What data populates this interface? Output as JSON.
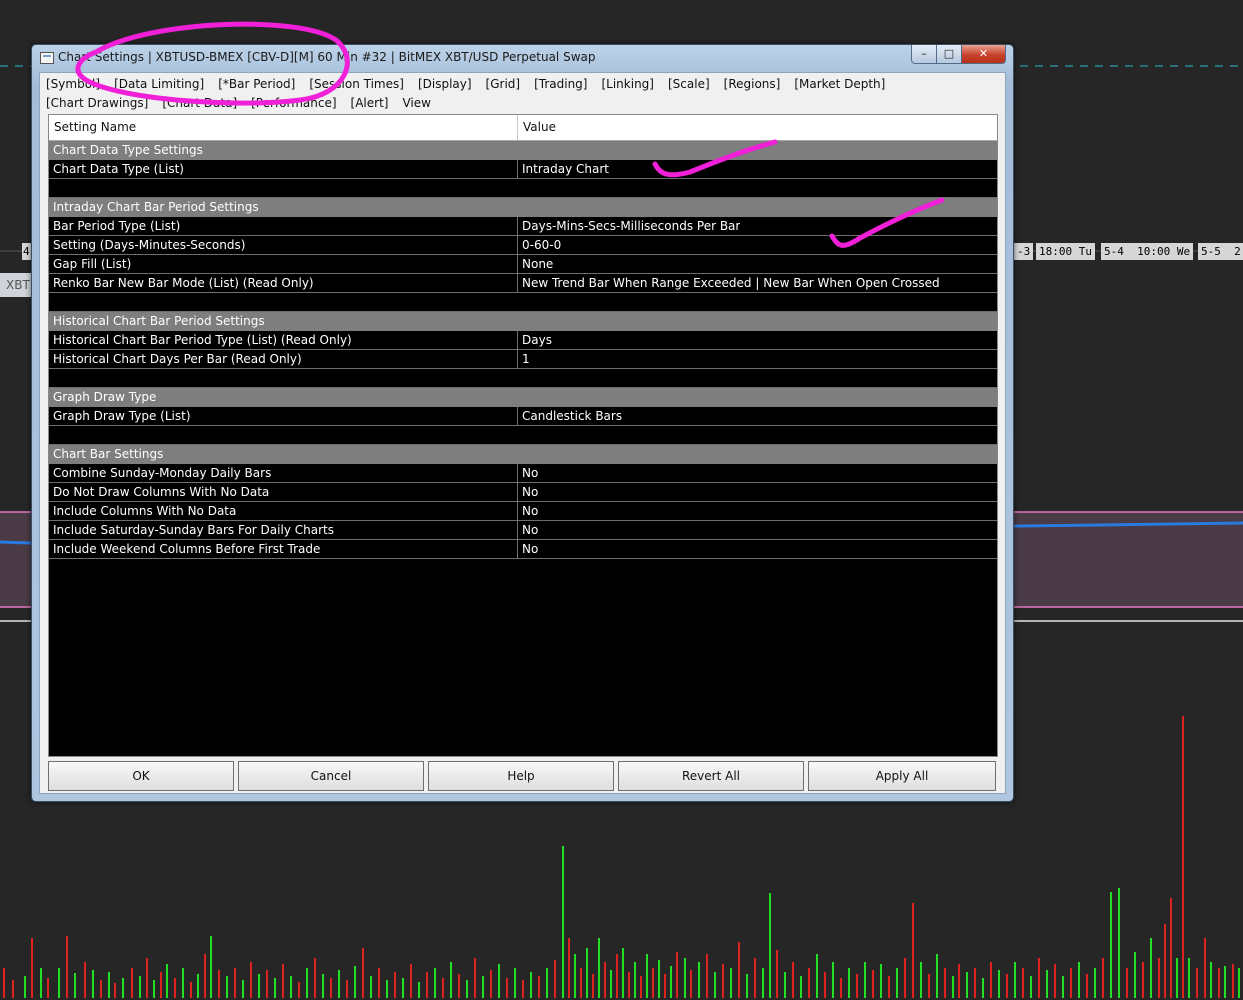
{
  "window": {
    "title": "Chart Settings | XBTUSD-BMEX [CBV-D][M]  60 Min  #32 | BitMEX XBT/USD Perpetual Swap",
    "min_glyph": "–",
    "max_glyph": "□",
    "close_glyph": "✕"
  },
  "tabs": [
    "[Symbol]",
    "[Data Limiting]",
    "[*Bar Period]",
    "[Session Times]",
    "[Display]",
    "[Grid]",
    "[Trading]",
    "[Linking]",
    "[Scale]",
    "[Regions]",
    "[Market Depth]",
    "[Chart Drawings]",
    "[Chart Data]",
    "[Performance]",
    "[Alert]",
    "View"
  ],
  "grid": {
    "headers": {
      "name": "Setting Name",
      "value": "Value"
    },
    "rows": [
      {
        "type": "section",
        "name": "Chart Data Type Settings"
      },
      {
        "type": "setting",
        "name": "Chart Data Type (List)",
        "value": "Intraday Chart"
      },
      {
        "type": "blank"
      },
      {
        "type": "section",
        "name": "Intraday Chart Bar Period Settings"
      },
      {
        "type": "setting",
        "name": "Bar Period Type (List)",
        "value": "Days-Mins-Secs-Milliseconds Per Bar"
      },
      {
        "type": "setting",
        "name": "Setting (Days-Minutes-Seconds)",
        "value": "0-60-0"
      },
      {
        "type": "setting",
        "name": "Gap Fill (List)",
        "value": "None"
      },
      {
        "type": "setting",
        "name": "Renko Bar New Bar Mode (List) (Read Only)",
        "value": "New Trend Bar When Range Exceeded | New Bar When Open Crossed"
      },
      {
        "type": "blank"
      },
      {
        "type": "section",
        "name": "Historical Chart Bar Period Settings"
      },
      {
        "type": "setting",
        "name": "Historical Chart Bar Period Type (List) (Read Only)",
        "value": "Days"
      },
      {
        "type": "setting",
        "name": "Historical Chart Days Per Bar (Read Only)",
        "value": "1"
      },
      {
        "type": "blank"
      },
      {
        "type": "section",
        "name": "Graph Draw Type"
      },
      {
        "type": "setting",
        "name": "Graph Draw Type (List)",
        "value": "Candlestick Bars"
      },
      {
        "type": "blank"
      },
      {
        "type": "section",
        "name": "Chart Bar Settings"
      },
      {
        "type": "setting",
        "name": "Combine Sunday-Monday Daily Bars",
        "value": "No"
      },
      {
        "type": "setting",
        "name": "Do Not Draw Columns With No Data",
        "value": "No"
      },
      {
        "type": "setting",
        "name": "Include Columns With No Data",
        "value": "No"
      },
      {
        "type": "setting",
        "name": "Include Saturday-Sunday Bars For Daily Charts",
        "value": "No"
      },
      {
        "type": "setting",
        "name": "Include Weekend Columns Before First Trade",
        "value": "No"
      }
    ]
  },
  "buttons": {
    "ok": "OK",
    "cancel": "Cancel",
    "help": "Help",
    "revert_all": "Revert All",
    "apply_all": "Apply All"
  },
  "background": {
    "left_axis_label": "4",
    "time_labels": [
      "-3",
      "18:00 Tu",
      "5-4  10:00 We",
      "5-5  2:"
    ],
    "side_tab": "XBT",
    "colors": {
      "up": "#22dd22",
      "down": "#dd2222",
      "cyan": "#2ab8c8",
      "pink": "#e67ac0",
      "blue": "#2a7be0"
    },
    "volume_bars": [
      [
        3,
        30,
        "r"
      ],
      [
        12,
        18,
        "r"
      ],
      [
        24,
        22,
        "g"
      ],
      [
        31,
        60,
        "r"
      ],
      [
        40,
        30,
        "g"
      ],
      [
        47,
        20,
        "r"
      ],
      [
        58,
        30,
        "g"
      ],
      [
        66,
        62,
        "r"
      ],
      [
        74,
        25,
        "g"
      ],
      [
        84,
        36,
        "r"
      ],
      [
        92,
        28,
        "g"
      ],
      [
        100,
        18,
        "r"
      ],
      [
        108,
        26,
        "g"
      ],
      [
        114,
        15,
        "r"
      ],
      [
        122,
        20,
        "g"
      ],
      [
        131,
        30,
        "r"
      ],
      [
        139,
        22,
        "g"
      ],
      [
        146,
        40,
        "r"
      ],
      [
        153,
        18,
        "g"
      ],
      [
        160,
        26,
        "r"
      ],
      [
        166,
        34,
        "g"
      ],
      [
        174,
        20,
        "r"
      ],
      [
        182,
        30,
        "g"
      ],
      [
        190,
        16,
        "r"
      ],
      [
        197,
        24,
        "g"
      ],
      [
        204,
        44,
        "r"
      ],
      [
        210,
        62,
        "g"
      ],
      [
        218,
        28,
        "r"
      ],
      [
        226,
        22,
        "g"
      ],
      [
        234,
        30,
        "r"
      ],
      [
        242,
        18,
        "g"
      ],
      [
        250,
        36,
        "r"
      ],
      [
        258,
        24,
        "g"
      ],
      [
        266,
        28,
        "r"
      ],
      [
        274,
        20,
        "g"
      ],
      [
        282,
        34,
        "r"
      ],
      [
        290,
        22,
        "g"
      ],
      [
        298,
        16,
        "r"
      ],
      [
        306,
        30,
        "g"
      ],
      [
        314,
        40,
        "r"
      ],
      [
        322,
        24,
        "g"
      ],
      [
        330,
        20,
        "r"
      ],
      [
        338,
        28,
        "g"
      ],
      [
        346,
        18,
        "r"
      ],
      [
        354,
        32,
        "g"
      ],
      [
        362,
        50,
        "r"
      ],
      [
        370,
        22,
        "g"
      ],
      [
        378,
        30,
        "r"
      ],
      [
        386,
        18,
        "g"
      ],
      [
        394,
        26,
        "r"
      ],
      [
        402,
        20,
        "g"
      ],
      [
        410,
        34,
        "r"
      ],
      [
        418,
        16,
        "g"
      ],
      [
        426,
        26,
        "r"
      ],
      [
        434,
        30,
        "g"
      ],
      [
        442,
        20,
        "r"
      ],
      [
        450,
        36,
        "g"
      ],
      [
        458,
        24,
        "r"
      ],
      [
        466,
        18,
        "g"
      ],
      [
        474,
        40,
        "r"
      ],
      [
        482,
        22,
        "g"
      ],
      [
        490,
        28,
        "r"
      ],
      [
        498,
        34,
        "g"
      ],
      [
        506,
        20,
        "r"
      ],
      [
        514,
        30,
        "g"
      ],
      [
        522,
        18,
        "r"
      ],
      [
        530,
        26,
        "g"
      ],
      [
        538,
        22,
        "r"
      ],
      [
        546,
        30,
        "g"
      ],
      [
        554,
        38,
        "r"
      ],
      [
        562,
        152,
        "g"
      ],
      [
        568,
        60,
        "r"
      ],
      [
        574,
        44,
        "g"
      ],
      [
        580,
        30,
        "r"
      ],
      [
        586,
        50,
        "g"
      ],
      [
        592,
        24,
        "r"
      ],
      [
        598,
        60,
        "g"
      ],
      [
        604,
        36,
        "r"
      ],
      [
        610,
        28,
        "g"
      ],
      [
        616,
        44,
        "r"
      ],
      [
        622,
        50,
        "g"
      ],
      [
        628,
        26,
        "r"
      ],
      [
        634,
        36,
        "g"
      ],
      [
        640,
        22,
        "r"
      ],
      [
        646,
        44,
        "g"
      ],
      [
        652,
        30,
        "r"
      ],
      [
        658,
        38,
        "g"
      ],
      [
        664,
        24,
        "r"
      ],
      [
        670,
        32,
        "g"
      ],
      [
        676,
        46,
        "r"
      ],
      [
        684,
        40,
        "g"
      ],
      [
        690,
        28,
        "r"
      ],
      [
        698,
        36,
        "g"
      ],
      [
        706,
        44,
        "r"
      ],
      [
        714,
        26,
        "g"
      ],
      [
        722,
        34,
        "r"
      ],
      [
        730,
        30,
        "g"
      ],
      [
        738,
        56,
        "r"
      ],
      [
        746,
        24,
        "g"
      ],
      [
        754,
        40,
        "r"
      ],
      [
        762,
        30,
        "g"
      ],
      [
        769,
        105,
        "g"
      ],
      [
        776,
        48,
        "r"
      ],
      [
        784,
        26,
        "g"
      ],
      [
        792,
        36,
        "r"
      ],
      [
        800,
        22,
        "g"
      ],
      [
        808,
        30,
        "r"
      ],
      [
        816,
        44,
        "g"
      ],
      [
        824,
        26,
        "r"
      ],
      [
        832,
        36,
        "g"
      ],
      [
        840,
        20,
        "r"
      ],
      [
        848,
        30,
        "g"
      ],
      [
        856,
        24,
        "r"
      ],
      [
        864,
        36,
        "g"
      ],
      [
        872,
        28,
        "r"
      ],
      [
        880,
        34,
        "g"
      ],
      [
        888,
        22,
        "r"
      ],
      [
        896,
        30,
        "g"
      ],
      [
        904,
        40,
        "r"
      ],
      [
        912,
        95,
        "r"
      ],
      [
        920,
        36,
        "g"
      ],
      [
        928,
        24,
        "r"
      ],
      [
        936,
        44,
        "g"
      ],
      [
        944,
        30,
        "r"
      ],
      [
        952,
        22,
        "g"
      ],
      [
        958,
        34,
        "r"
      ],
      [
        966,
        26,
        "g"
      ],
      [
        974,
        30,
        "r"
      ],
      [
        982,
        20,
        "g"
      ],
      [
        990,
        36,
        "r"
      ],
      [
        998,
        28,
        "g"
      ],
      [
        1006,
        24,
        "r"
      ],
      [
        1014,
        36,
        "g"
      ],
      [
        1022,
        30,
        "r"
      ],
      [
        1030,
        22,
        "g"
      ],
      [
        1038,
        40,
        "r"
      ],
      [
        1046,
        28,
        "g"
      ],
      [
        1054,
        34,
        "r"
      ],
      [
        1062,
        22,
        "g"
      ],
      [
        1070,
        30,
        "r"
      ],
      [
        1078,
        36,
        "g"
      ],
      [
        1086,
        24,
        "r"
      ],
      [
        1094,
        30,
        "g"
      ],
      [
        1102,
        40,
        "r"
      ],
      [
        1110,
        106,
        "g"
      ],
      [
        1118,
        110,
        "g"
      ],
      [
        1126,
        30,
        "r"
      ],
      [
        1134,
        46,
        "g"
      ],
      [
        1142,
        36,
        "r"
      ],
      [
        1150,
        60,
        "g"
      ],
      [
        1158,
        40,
        "r"
      ],
      [
        1164,
        74,
        "r"
      ],
      [
        1170,
        100,
        "r"
      ],
      [
        1176,
        40,
        "g"
      ],
      [
        1182,
        282,
        "r"
      ],
      [
        1188,
        40,
        "g"
      ],
      [
        1196,
        30,
        "r"
      ],
      [
        1204,
        60,
        "r"
      ],
      [
        1210,
        36,
        "g"
      ],
      [
        1218,
        30,
        "r"
      ],
      [
        1224,
        32,
        "g"
      ],
      [
        1232,
        34,
        "r"
      ],
      [
        1238,
        30,
        "g"
      ]
    ]
  }
}
